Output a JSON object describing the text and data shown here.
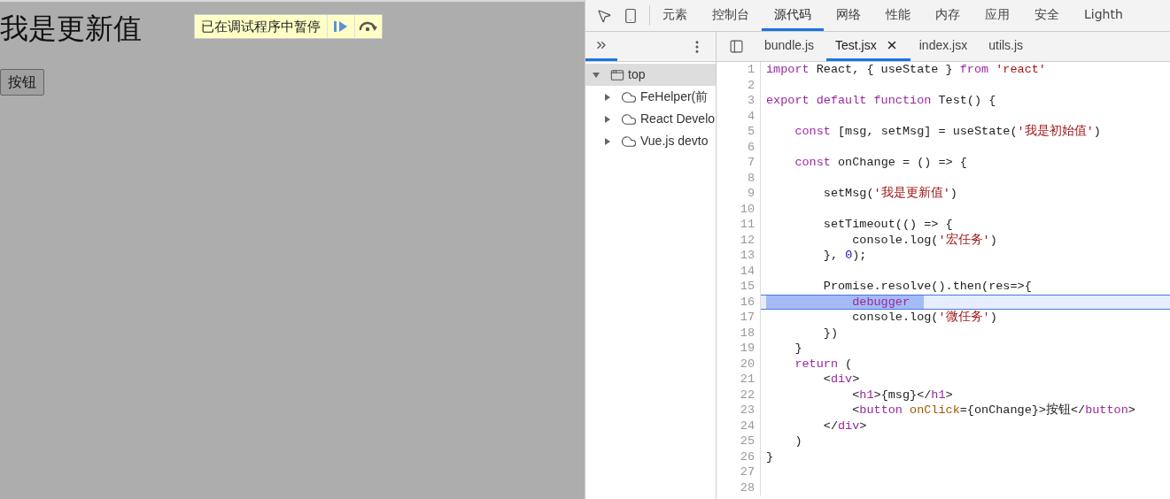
{
  "page": {
    "heading": "我是更新值",
    "button": "按钮"
  },
  "paused_banner": {
    "text": "已在调试程序中暂停"
  },
  "devtools": {
    "tabs": [
      {
        "label": "元素",
        "selected": false
      },
      {
        "label": "控制台",
        "selected": false
      },
      {
        "label": "源代码",
        "selected": true
      },
      {
        "label": "网络",
        "selected": false
      },
      {
        "label": "性能",
        "selected": false
      },
      {
        "label": "内存",
        "selected": false
      },
      {
        "label": "应用",
        "selected": false
      },
      {
        "label": "安全",
        "selected": false
      },
      {
        "label": "Lighth",
        "selected": false
      }
    ],
    "tree": [
      {
        "label": "top",
        "kind": "frame",
        "expanded": true,
        "selected": true,
        "children": [
          {
            "label": "FeHelper(前",
            "kind": "extension",
            "expanded": false,
            "selected": false
          },
          {
            "label": "React Develo",
            "kind": "extension",
            "expanded": false,
            "selected": false
          },
          {
            "label": "Vue.js devto",
            "kind": "extension",
            "expanded": false,
            "selected": false
          }
        ]
      }
    ],
    "file_tabs": [
      {
        "label": "bundle.js",
        "selected": false
      },
      {
        "label": "Test.jsx",
        "selected": true
      },
      {
        "label": "index.jsx",
        "selected": false
      },
      {
        "label": "utils.js",
        "selected": false
      }
    ],
    "code": [
      {
        "number": "1",
        "highlighted": false,
        "tokens": [
          {
            "kind": "keyword",
            "text": "import"
          },
          {
            "kind": "plain",
            "text": " React, { useState } "
          },
          {
            "kind": "keyword",
            "text": "from"
          },
          {
            "kind": "string",
            "text": " 'react'"
          }
        ]
      },
      {
        "number": "2",
        "highlighted": false
      },
      {
        "number": "3",
        "highlighted": false,
        "tokens": [
          {
            "kind": "keyword",
            "text": "export default function"
          },
          {
            "kind": "plain",
            "text": " Test() {"
          }
        ]
      },
      {
        "number": "4",
        "highlighted": false
      },
      {
        "number": "5",
        "highlighted": false,
        "tokens": [
          {
            "kind": "keyword",
            "text": "    const"
          },
          {
            "kind": "plain",
            "text": " [msg, setMsg] = useState("
          },
          {
            "kind": "string",
            "text": "'我是初始值'"
          },
          {
            "kind": "plain",
            "text": ")"
          }
        ]
      },
      {
        "number": "6",
        "highlighted": false
      },
      {
        "number": "7",
        "highlighted": false,
        "tokens": [
          {
            "kind": "keyword",
            "text": "    const"
          },
          {
            "kind": "plain",
            "text": " onChange = () => {"
          }
        ]
      },
      {
        "number": "8",
        "highlighted": false
      },
      {
        "number": "9",
        "highlighted": false,
        "tokens": [
          {
            "kind": "plain",
            "text": "        setMsg("
          },
          {
            "kind": "string",
            "text": "'我是更新值'"
          },
          {
            "kind": "plain",
            "text": ")"
          }
        ]
      },
      {
        "number": "10",
        "highlighted": false
      },
      {
        "number": "11",
        "highlighted": false,
        "tokens": [
          {
            "kind": "plain",
            "text": "        setTimeout(() => {"
          }
        ]
      },
      {
        "number": "12",
        "highlighted": false,
        "tokens": [
          {
            "kind": "plain",
            "text": "            console.log("
          },
          {
            "kind": "string",
            "text": "'宏任务'"
          },
          {
            "kind": "plain",
            "text": ")"
          }
        ]
      },
      {
        "number": "13",
        "highlighted": false,
        "tokens": [
          {
            "kind": "plain",
            "text": "        }, "
          },
          {
            "kind": "number",
            "text": "0"
          },
          {
            "kind": "plain",
            "text": ");"
          }
        ]
      },
      {
        "number": "14",
        "highlighted": false
      },
      {
        "number": "15",
        "highlighted": false,
        "tokens": [
          {
            "kind": "plain",
            "text": "        Promise.resolve().then(res=>{"
          }
        ]
      },
      {
        "number": "16",
        "highlighted": true,
        "tokens": [
          {
            "kind": "keyword",
            "text": "            debugger"
          }
        ]
      },
      {
        "number": "17",
        "highlighted": false,
        "tokens": [
          {
            "kind": "plain",
            "text": "            console.log("
          },
          {
            "kind": "string",
            "text": "'微任务'"
          },
          {
            "kind": "plain",
            "text": ")"
          }
        ]
      },
      {
        "number": "18",
        "highlighted": false,
        "tokens": [
          {
            "kind": "plain",
            "text": "        })"
          }
        ]
      },
      {
        "number": "19",
        "highlighted": false,
        "tokens": [
          {
            "kind": "plain",
            "text": "    }"
          }
        ]
      },
      {
        "number": "20",
        "highlighted": false,
        "tokens": [
          {
            "kind": "keyword",
            "text": "    return"
          },
          {
            "kind": "plain",
            "text": " ("
          }
        ]
      },
      {
        "number": "21",
        "highlighted": false,
        "tokens": [
          {
            "kind": "plain",
            "text": "        <"
          },
          {
            "kind": "tag",
            "text": "div"
          },
          {
            "kind": "plain",
            "text": ">"
          }
        ]
      },
      {
        "number": "22",
        "highlighted": false,
        "tokens": [
          {
            "kind": "plain",
            "text": "            <"
          },
          {
            "kind": "tag",
            "text": "h1"
          },
          {
            "kind": "plain",
            "text": ">{msg}</"
          },
          {
            "kind": "tag",
            "text": "h1"
          },
          {
            "kind": "plain",
            "text": ">"
          }
        ]
      },
      {
        "number": "23",
        "highlighted": false,
        "tokens": [
          {
            "kind": "plain",
            "text": "            <"
          },
          {
            "kind": "tag",
            "text": "button"
          },
          {
            "kind": "attr",
            "text": " onClick"
          },
          {
            "kind": "plain",
            "text": "={onChange}>按钮</"
          },
          {
            "kind": "tag",
            "text": "button"
          },
          {
            "kind": "plain",
            "text": ">"
          }
        ]
      },
      {
        "number": "24",
        "highlighted": false,
        "tokens": [
          {
            "kind": "plain",
            "text": "        </"
          },
          {
            "kind": "tag",
            "text": "div"
          },
          {
            "kind": "plain",
            "text": ">"
          }
        ]
      },
      {
        "number": "25",
        "highlighted": false,
        "tokens": [
          {
            "kind": "plain",
            "text": "    )"
          }
        ]
      },
      {
        "number": "26",
        "highlighted": false,
        "tokens": [
          {
            "kind": "plain",
            "text": "}"
          }
        ]
      },
      {
        "number": "27",
        "highlighted": false
      },
      {
        "number": "28",
        "highlighted": false
      }
    ]
  }
}
